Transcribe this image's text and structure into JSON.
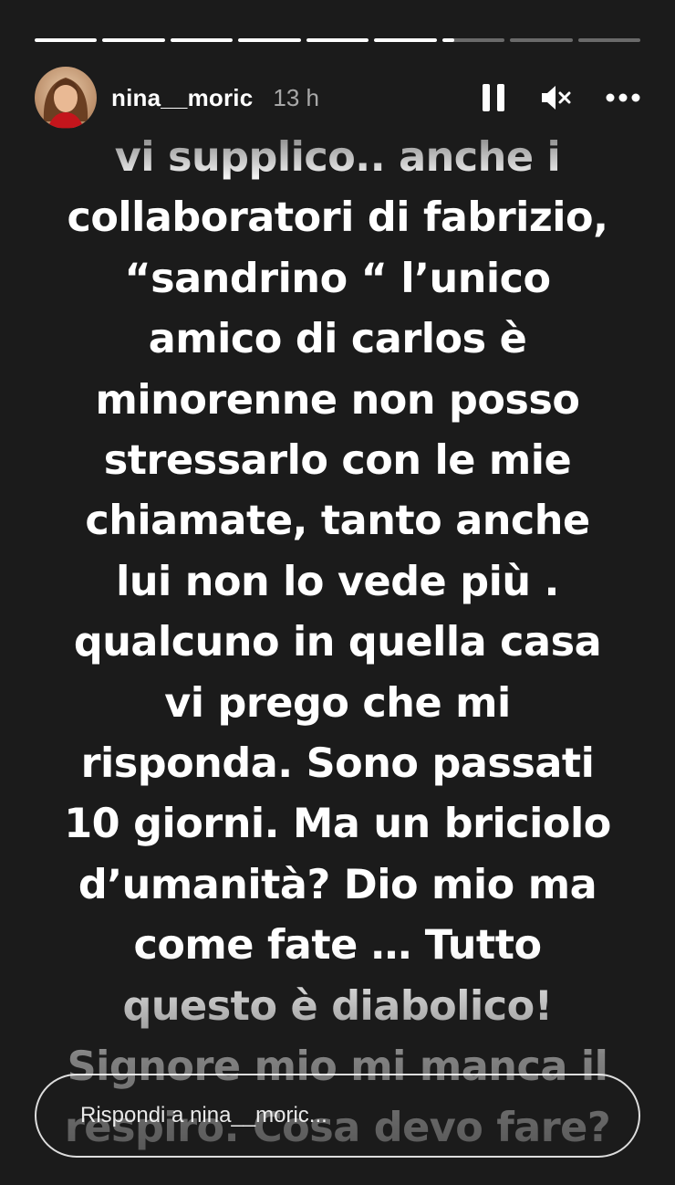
{
  "progress": {
    "segments": [
      1,
      1,
      1,
      1,
      1,
      1,
      0.2,
      0,
      0
    ]
  },
  "header": {
    "username": "nina__moric",
    "time": "13 h"
  },
  "controls": {
    "pause_icon": "pause-icon",
    "mute_icon": "speaker-muted-icon",
    "more_icon": "more-dots-icon"
  },
  "story_text": {
    "lines": [
      "vi supplico.. anche i",
      "collaboratori di fabrizio,",
      "“sandrino “ l’unico",
      "amico di carlos è",
      "minorenne non posso",
      "stressarlo con le mie",
      "chiamate, tanto anche",
      "lui non lo vede più .",
      "qualcuno in quella casa",
      "vi prego che mi",
      "risponda. Sono passati",
      "10 giorni. Ma un briciolo",
      "d’umanità?  Dio mio ma",
      "come fate … Tutto",
      "questo è diabolico!",
      "Signore mio mi manca il",
      "respiro. Cosa devo fare?"
    ]
  },
  "reply": {
    "placeholder": "Rispondi a nina__moric..."
  },
  "colors": {
    "background": "#1b1b1b",
    "text": "#ffffff"
  }
}
